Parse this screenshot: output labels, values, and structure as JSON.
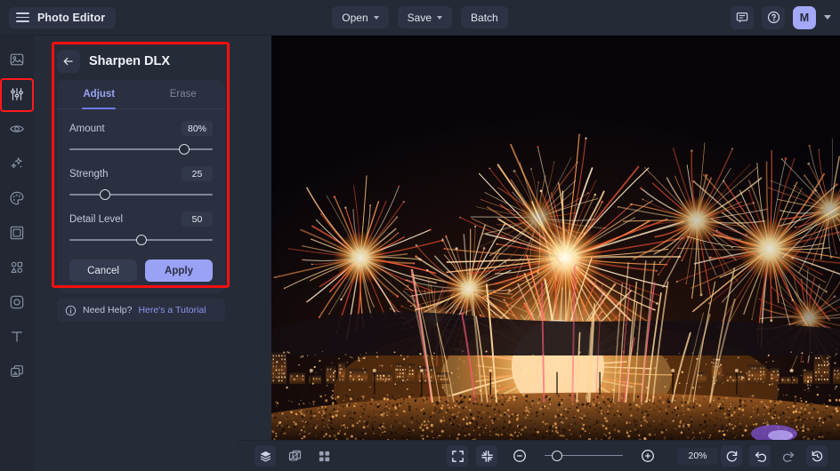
{
  "app": {
    "title": "Photo Editor",
    "menu_icon": "hamburger-icon"
  },
  "toolbar": {
    "open_label": "Open",
    "save_label": "Save",
    "batch_label": "Batch",
    "feedback_icon": "comment-icon",
    "help_icon": "question-circle-icon",
    "avatar_initial": "M",
    "account_caret_icon": "chevron-down-icon"
  },
  "rail": {
    "items": [
      {
        "name": "image",
        "icon": "image-icon",
        "selected": false
      },
      {
        "name": "adjust",
        "icon": "sliders-icon",
        "selected": true
      },
      {
        "name": "retouch",
        "icon": "eye-icon",
        "selected": false
      },
      {
        "name": "effects",
        "icon": "sparkles-icon",
        "selected": false
      },
      {
        "name": "color",
        "icon": "palette-icon",
        "selected": false
      },
      {
        "name": "frame",
        "icon": "frame-icon",
        "selected": false
      },
      {
        "name": "shapes",
        "icon": "shapes-icon",
        "selected": false
      },
      {
        "name": "focus",
        "icon": "focus-icon",
        "selected": false
      },
      {
        "name": "text",
        "icon": "text-icon",
        "selected": false
      },
      {
        "name": "layers",
        "icon": "layers-copy-icon",
        "selected": false
      }
    ]
  },
  "panel": {
    "back_icon": "arrow-left-icon",
    "title": "Sharpen DLX",
    "tabs": [
      {
        "label": "Adjust",
        "active": true
      },
      {
        "label": "Erase",
        "active": false
      }
    ],
    "controls": [
      {
        "label": "Amount",
        "value": "80%",
        "percent": 80,
        "filled": false
      },
      {
        "label": "Strength",
        "value": "25",
        "percent": 25,
        "filled": false
      },
      {
        "label": "Detail Level",
        "value": "50",
        "percent": 50,
        "filled": true
      }
    ],
    "cancel_label": "Cancel",
    "apply_label": "Apply",
    "help_icon": "info-circle-icon",
    "help_text": "Need Help?",
    "help_link": "Here's a Tutorial"
  },
  "bottombar": {
    "left_tools": [
      {
        "name": "layers",
        "icon": "layers-icon",
        "boxed": true
      },
      {
        "name": "compare",
        "icon": "compare-icon",
        "boxed": false
      },
      {
        "name": "grid",
        "icon": "grid-icon",
        "boxed": false
      }
    ],
    "view_tools": [
      {
        "name": "fit-screen",
        "icon": "expand-icon",
        "boxed": true
      },
      {
        "name": "actual-size",
        "icon": "collapse-icon",
        "boxed": true
      }
    ],
    "zoom_out_icon": "minus-circle-icon",
    "zoom_in_icon": "plus-circle-icon",
    "zoom_value": "20%",
    "zoom_percent": 20,
    "right_tools": [
      {
        "name": "reset",
        "icon": "refresh-icon",
        "boxed": true
      },
      {
        "name": "undo",
        "icon": "undo-icon",
        "boxed": true
      },
      {
        "name": "redo",
        "icon": "redo-icon",
        "boxed": false
      },
      {
        "name": "history",
        "icon": "history-icon",
        "boxed": true
      }
    ]
  },
  "canvas": {
    "image_description": "Fireworks display over a city at night with crowd silhouettes",
    "highlight_color": "#fa0f0f",
    "accent_color": "#9aa2f6"
  }
}
